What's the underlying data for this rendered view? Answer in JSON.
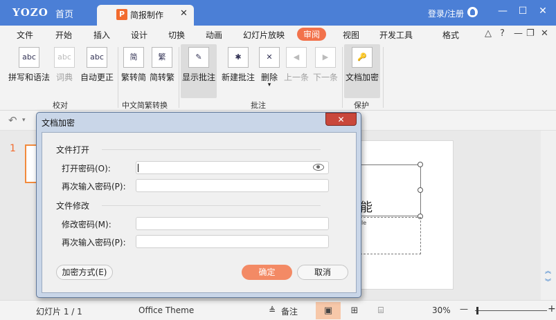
{
  "app": {
    "logo": "YOZO",
    "home_tab": "首页",
    "doc_tab": {
      "badge": "P",
      "title": "简报制作",
      "close": "✕"
    },
    "login": "登录/注册",
    "window_controls": {
      "minimize": "—",
      "maximize": "☐",
      "close": "✕"
    }
  },
  "menu": {
    "items": [
      "文件",
      "开始",
      "插入",
      "设计",
      "切换",
      "动画",
      "幻灯片放映",
      "审阅",
      "视图",
      "开发工具",
      "格式"
    ],
    "active": "审阅",
    "right_icons": [
      "collapse-icon",
      "help-icon",
      "restore-icon",
      "close-icon"
    ],
    "right_glyphs": {
      "collapse": "△",
      "help": "?",
      "restore": "❐",
      "close": "✕"
    }
  },
  "ribbon": {
    "groups": [
      {
        "label": "校对",
        "buttons": [
          {
            "label": "拼写和语法",
            "glyph": "abc",
            "disabled": false
          },
          {
            "label": "词典",
            "glyph": "abc",
            "disabled": true
          },
          {
            "label": "自动更正",
            "glyph": "abc",
            "disabled": false
          }
        ]
      },
      {
        "label": "中文简繁转换",
        "buttons": [
          {
            "label": "繁转简",
            "glyph": "简",
            "disabled": false
          },
          {
            "label": "简转繁",
            "glyph": "繁",
            "disabled": false
          }
        ]
      },
      {
        "label": "批注",
        "buttons": [
          {
            "label": "显示批注",
            "glyph": "✎",
            "disabled": false,
            "selected": true
          },
          {
            "label": "新建批注",
            "glyph": "✱",
            "disabled": false
          },
          {
            "label": "删除",
            "glyph": "✕",
            "disabled": false
          },
          {
            "label": "上一条",
            "glyph": "◀",
            "disabled": true
          },
          {
            "label": "下一条",
            "glyph": "▶",
            "disabled": true
          }
        ]
      },
      {
        "label": "保护",
        "buttons": [
          {
            "label": "文档加密",
            "glyph": "🔑",
            "disabled": false,
            "selected": true
          }
        ]
      }
    ],
    "dropdown_arrow": "▾"
  },
  "quickbar": {
    "undo_glyph": "↶",
    "arrow": "▾"
  },
  "workspace": {
    "slide_number": "1",
    "slide_big_char": "能",
    "slide_small_text": "le"
  },
  "status": {
    "slide_info": "幻灯片 1 / 1",
    "theme": "Office Theme",
    "notes": "备注",
    "notes_glyph": "≜",
    "zoom": "30%",
    "zoom_minus": "—",
    "zoom_plus": "+",
    "view_glyphs": [
      "▣",
      "⊞",
      "⌸"
    ]
  },
  "dialog": {
    "title": "文档加密",
    "close": "✕",
    "open_section": "文件打开",
    "open_password_label": "打开密码(O):",
    "open_password_value": "",
    "reenter_open_label": "再次输入密码(P):",
    "modify_section": "文件修改",
    "modify_password_label": "修改密码(M):",
    "reenter_modify_label": "再次输入密码(P):",
    "encrypt_method": "加密方式(E)",
    "ok": "确定",
    "cancel": "取消"
  },
  "colors": {
    "titlebar": "#4b7fd6",
    "accent": "#f2724b",
    "primary_button": "#f38a65",
    "dialog_close": "#c9473b"
  }
}
